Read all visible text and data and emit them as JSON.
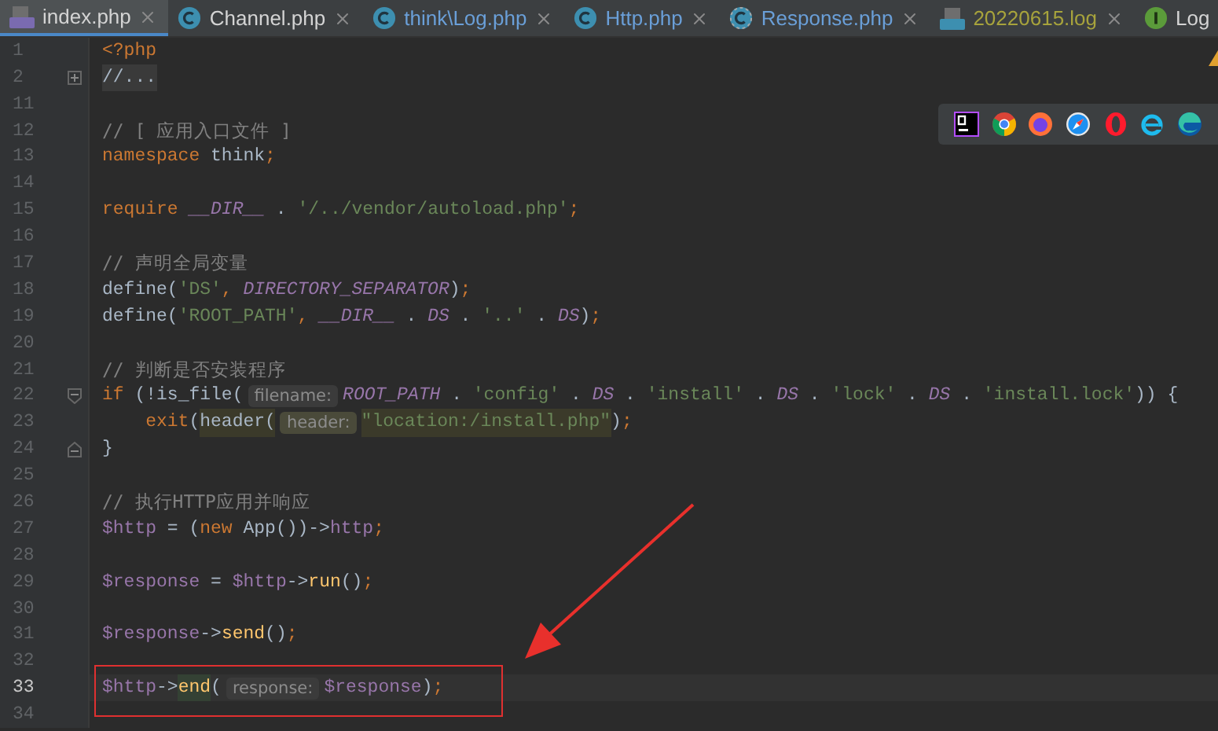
{
  "tabs": [
    {
      "label": "index.php",
      "kind": "php",
      "selected": true,
      "color": "#d4d4d4",
      "closable": true
    },
    {
      "label": "Channel.php",
      "kind": "class",
      "selected": false,
      "color": "#d4d4d4",
      "closable": true
    },
    {
      "label": "think\\Log.php",
      "kind": "class",
      "selected": false,
      "color": "#6a9fd8",
      "closable": true
    },
    {
      "label": "Http.php",
      "kind": "class",
      "selected": false,
      "color": "#6a9fd8",
      "closable": true
    },
    {
      "label": "Response.php",
      "kind": "class-alt",
      "selected": false,
      "color": "#6a9fd8",
      "closable": true
    },
    {
      "label": "20220615.log",
      "kind": "log",
      "selected": false,
      "color": "#a7a33c",
      "closable": true
    },
    {
      "label": "Log",
      "kind": "interface",
      "selected": false,
      "color": "#d4d4d4",
      "closable": false
    }
  ],
  "browsers": [
    {
      "kind": "ps"
    },
    {
      "kind": "chrome"
    },
    {
      "kind": "firefox"
    },
    {
      "kind": "safari"
    },
    {
      "kind": "opera"
    },
    {
      "kind": "ie"
    },
    {
      "kind": "edge"
    }
  ],
  "lines": [
    {
      "number": "1",
      "current": false,
      "tokens": [
        {
          "kind": "kw",
          "text": "<?php"
        }
      ]
    },
    {
      "number": "2",
      "current": false,
      "fold": {
        "kind": "collapsed"
      },
      "tokens": [
        {
          "kind": "folded",
          "text": "//..."
        }
      ]
    },
    {
      "number": "11",
      "current": false
    },
    {
      "number": "12",
      "current": false,
      "tokens": [
        {
          "kind": "cmt",
          "text": "// [ 应用入口文件 ]"
        }
      ]
    },
    {
      "number": "13",
      "current": false,
      "tokens": [
        {
          "kind": "kw",
          "text": "namespace"
        },
        {
          "kind": "plain",
          "text": " think"
        },
        {
          "kind": "kw",
          "text": ";"
        }
      ]
    },
    {
      "number": "14",
      "current": false
    },
    {
      "number": "15",
      "current": false,
      "tokens": [
        {
          "kind": "kw",
          "text": "require"
        },
        {
          "kind": "const",
          "text": " __DIR__"
        },
        {
          "kind": "plain",
          "text": " . "
        },
        {
          "kind": "str",
          "text": "'/../vendor/autoload.php'"
        },
        {
          "kind": "kw",
          "text": ";"
        }
      ]
    },
    {
      "number": "16",
      "current": false
    },
    {
      "number": "17",
      "current": false,
      "tokens": [
        {
          "kind": "cmt",
          "text": "// 声明全局变量"
        }
      ]
    },
    {
      "number": "18",
      "current": false,
      "tokens": [
        {
          "kind": "plain",
          "text": "define("
        },
        {
          "kind": "str",
          "text": "'DS'"
        },
        {
          "kind": "kw",
          "text": ", "
        },
        {
          "kind": "const",
          "text": "DIRECTORY_SEPARATOR"
        },
        {
          "kind": "plain",
          "text": ")"
        },
        {
          "kind": "kw",
          "text": ";"
        }
      ]
    },
    {
      "number": "19",
      "current": false,
      "tokens": [
        {
          "kind": "plain",
          "text": "define("
        },
        {
          "kind": "str",
          "text": "'ROOT_PATH'"
        },
        {
          "kind": "kw",
          "text": ", "
        },
        {
          "kind": "const",
          "text": "__DIR__"
        },
        {
          "kind": "plain",
          "text": " . "
        },
        {
          "kind": "const",
          "text": "DS"
        },
        {
          "kind": "plain",
          "text": " . "
        },
        {
          "kind": "str",
          "text": "'..'"
        },
        {
          "kind": "plain",
          "text": " . "
        },
        {
          "kind": "const",
          "text": "DS"
        },
        {
          "kind": "plain",
          "text": ")"
        },
        {
          "kind": "kw",
          "text": ";"
        }
      ]
    },
    {
      "number": "20",
      "current": false
    },
    {
      "number": "21",
      "current": false,
      "tokens": [
        {
          "kind": "cmt",
          "text": "// 判断是否安装程序"
        }
      ]
    },
    {
      "number": "22",
      "current": false,
      "fold": {
        "kind": "start"
      },
      "tokens": [
        {
          "kind": "kw",
          "text": "if"
        },
        {
          "kind": "plain",
          "text": " (!is_file("
        },
        {
          "kind": "hint",
          "text": "filename:"
        },
        {
          "kind": "const",
          "text": "ROOT_PATH"
        },
        {
          "kind": "plain",
          "text": " . "
        },
        {
          "kind": "str",
          "text": "'config'"
        },
        {
          "kind": "plain",
          "text": " . "
        },
        {
          "kind": "const",
          "text": "DS"
        },
        {
          "kind": "plain",
          "text": " . "
        },
        {
          "kind": "str",
          "text": "'install'"
        },
        {
          "kind": "plain",
          "text": " . "
        },
        {
          "kind": "const",
          "text": "DS"
        },
        {
          "kind": "plain",
          "text": " . "
        },
        {
          "kind": "str",
          "text": "'lock'"
        },
        {
          "kind": "plain",
          "text": " . "
        },
        {
          "kind": "const",
          "text": "DS"
        },
        {
          "kind": "plain",
          "text": " . "
        },
        {
          "kind": "str",
          "text": "'install.lock'"
        },
        {
          "kind": "plain",
          "text": ")) {"
        }
      ]
    },
    {
      "number": "23",
      "current": false,
      "tokens": [
        {
          "kind": "kw",
          "text": "    exit"
        },
        {
          "kind": "plain",
          "text": "("
        },
        {
          "kind": "plain-hl",
          "text": "header("
        },
        {
          "kind": "hint-hl",
          "text": "header:"
        },
        {
          "kind": "str-hl",
          "text": "\"location:/install.php\""
        },
        {
          "kind": "plain",
          "text": ")"
        },
        {
          "kind": "kw",
          "text": ";"
        }
      ]
    },
    {
      "number": "24",
      "current": false,
      "fold": {
        "kind": "end"
      },
      "tokens": [
        {
          "kind": "plain",
          "text": "}"
        }
      ]
    },
    {
      "number": "25",
      "current": false
    },
    {
      "number": "26",
      "current": false,
      "tokens": [
        {
          "kind": "cmt",
          "text": "// 执行HTTP应用并响应"
        }
      ]
    },
    {
      "number": "27",
      "current": false,
      "tokens": [
        {
          "kind": "var",
          "text": "$http"
        },
        {
          "kind": "plain",
          "text": " = ("
        },
        {
          "kind": "kw",
          "text": "new"
        },
        {
          "kind": "plain",
          "text": " App())->"
        },
        {
          "kind": "var",
          "text": "http"
        },
        {
          "kind": "kw",
          "text": ";"
        }
      ]
    },
    {
      "number": "28",
      "current": false
    },
    {
      "number": "29",
      "current": false,
      "tokens": [
        {
          "kind": "var",
          "text": "$response"
        },
        {
          "kind": "plain",
          "text": " = "
        },
        {
          "kind": "var",
          "text": "$http"
        },
        {
          "kind": "plain",
          "text": "->"
        },
        {
          "kind": "fn",
          "text": "run"
        },
        {
          "kind": "plain",
          "text": "()"
        },
        {
          "kind": "kw",
          "text": ";"
        }
      ]
    },
    {
      "number": "30",
      "current": false
    },
    {
      "number": "31",
      "current": false,
      "tokens": [
        {
          "kind": "var",
          "text": "$response"
        },
        {
          "kind": "plain",
          "text": "->"
        },
        {
          "kind": "fn",
          "text": "send"
        },
        {
          "kind": "plain",
          "text": "()"
        },
        {
          "kind": "kw",
          "text": ";"
        }
      ]
    },
    {
      "number": "32",
      "current": false
    },
    {
      "number": "33",
      "current": true,
      "tokens": [
        {
          "kind": "var",
          "text": "$http"
        },
        {
          "kind": "plain",
          "text": "->"
        },
        {
          "kind": "fn-match",
          "text": "end"
        },
        {
          "kind": "plain",
          "text": "("
        },
        {
          "kind": "hint",
          "text": "response:"
        },
        {
          "kind": "var",
          "text": "$response"
        },
        {
          "kind": "plain",
          "text": ")"
        },
        {
          "kind": "kw",
          "text": ";"
        }
      ]
    },
    {
      "number": "34",
      "current": false
    }
  ]
}
